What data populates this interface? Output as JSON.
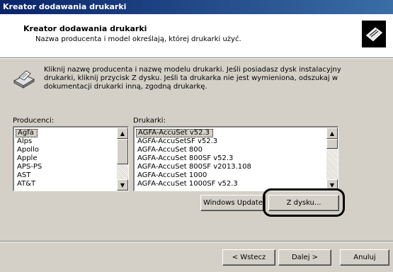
{
  "window": {
    "title": "Kreator dodawania drukarki"
  },
  "header": {
    "title": "Kreator dodawania drukarki",
    "subtitle": "Nazwa producenta i model określają, której drukarki użyć."
  },
  "instructions": "Kliknij nazwę producenta i nazwę modelu drukarki. Jeśli posiadasz dysk instalacyjny drukarki, kliknij przycisk Z dysku. Jeśli ta drukarka nie jest wymieniona, odszukaj w dokumentacji drukarki inną, zgodną drukarkę.",
  "manufacturers": {
    "label": "Producenci:",
    "items": [
      "Agfa",
      "Alps",
      "Apollo",
      "Apple",
      "APS-PS",
      "AST",
      "AT&T"
    ],
    "selected": "Agfa"
  },
  "printers": {
    "label": "Drukarki:",
    "items": [
      "AGFA-AccuSet v52.3",
      "AGFA-AccuSetSF v52.3",
      "AGFA-AccuSet 800",
      "AGFA-AccuSet 800SF v52.3",
      "AGFA-AccuSet 800SF v2013.108",
      "AGFA-AccuSet 1000",
      "AGFA-AccuSet 1000SF v52.3"
    ],
    "selected": "AGFA-AccuSet v52.3"
  },
  "buttons": {
    "windows_update": "Windows Update",
    "have_disk": "Z dysku...",
    "back": "< Wstecz",
    "next": "Dalej >",
    "cancel": "Anuluj"
  }
}
